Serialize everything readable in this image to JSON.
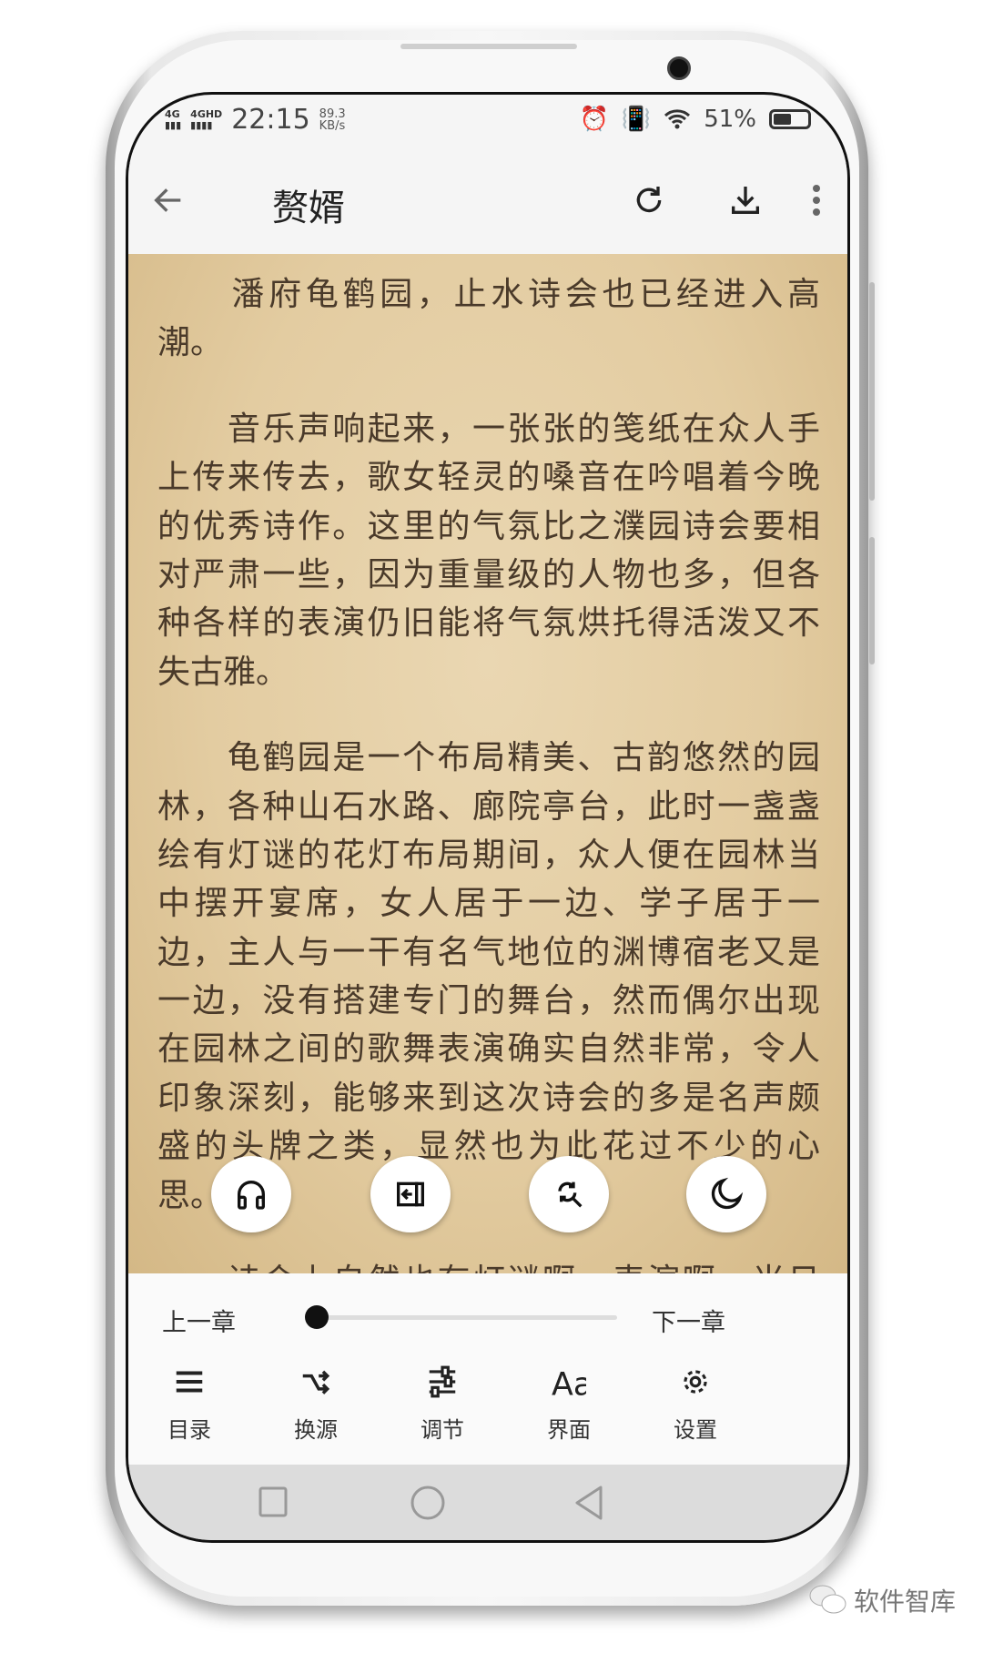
{
  "status_bar": {
    "network1": "4G",
    "network2": "4GHD",
    "time": "22:15",
    "speed_value": "89.3",
    "speed_unit": "KB/s",
    "battery": "51%",
    "battery_level": 0.51
  },
  "toolbar": {
    "title": "赘婿",
    "icons": [
      "back-arrow-icon",
      "refresh-icon",
      "download-icon",
      "more-vert-icon"
    ]
  },
  "content": {
    "paragraphs": [
      {
        "lines": [
          "　　潘府龟鹤园，止水诗会也已经进入高",
          "潮。"
        ]
      },
      {
        "lines": [
          "　　音乐声响起来，一张张的笺纸在众人手",
          "上传来传去，歌女轻灵的嗓音在吟唱着今晚",
          "的优秀诗作。这里的气氛比之濮园诗会要相",
          "对严肃一些，因为重量级的人物也多，但各",
          "种各样的表演仍旧能将气氛烘托得活泼又不",
          "失古雅。"
        ]
      },
      {
        "lines": [
          "　　龟鹤园是一个布局精美、古韵悠然的园",
          "林，各种山石水路、廊院亭台，此时一盏盏",
          "绘有灯谜的花灯布局期间，众人便在园林当",
          "中摆开宴席，女人居于一边、学子居于一",
          "边，主人与一干有名气地位的渊博宿老又是",
          "一边，没有搭建专门的舞台，然而偶尔出现",
          "在园林之间的歌舞表演确实自然非常，令人",
          "印象深刻，能够来到这次诗会的多是名声颇",
          "盛的头牌之类，显然也为此花过不少的心",
          "思。"
        ]
      },
      {
        "lines": [
          "　　诗会上自然也有灯谜啊，表演啊，当日"
        ]
      }
    ]
  },
  "fabs": [
    "headphones-icon",
    "exit-page-icon",
    "search-replace-icon",
    "moon-icon"
  ],
  "panel": {
    "prev_chapter": "上一章",
    "next_chapter": "下一章",
    "progress": 0,
    "menu": [
      {
        "label": "目录",
        "icon": "list-icon"
      },
      {
        "label": "换源",
        "icon": "shuffle-icon"
      },
      {
        "label": "调节",
        "icon": "tune-icon"
      },
      {
        "label": "界面",
        "icon": "font-icon"
      },
      {
        "label": "设置",
        "icon": "gear-icon"
      }
    ]
  },
  "nav": [
    "recents-square-icon",
    "home-circle-icon",
    "back-triangle-icon"
  ],
  "watermark": "软件智库"
}
